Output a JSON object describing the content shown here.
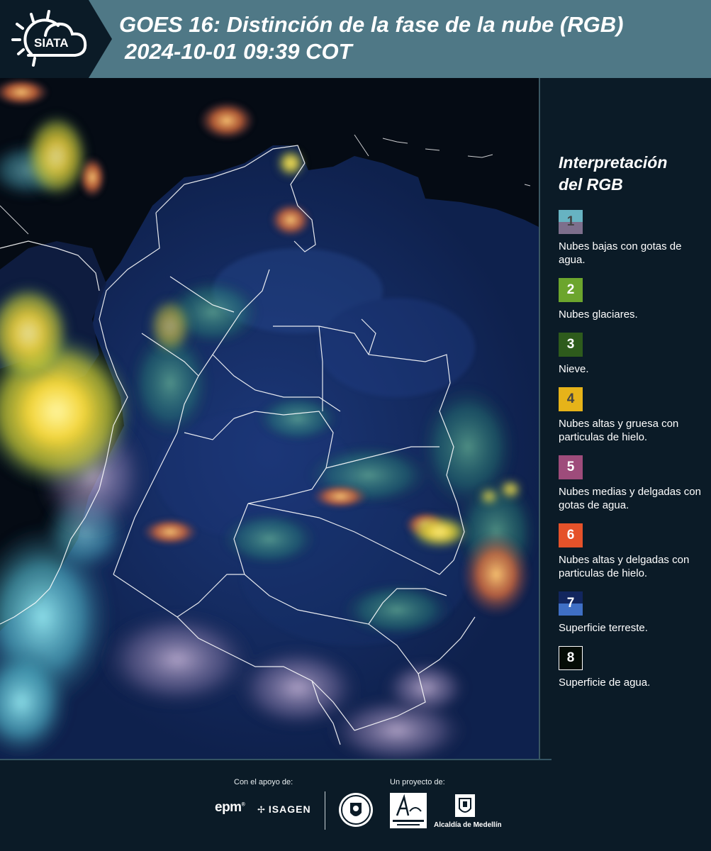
{
  "header": {
    "logo_text": "SIATA",
    "title_line1": "GOES 16: Distinción de la fase de la nube (RGB)",
    "title_line2": "2024-10-01 09:39 COT"
  },
  "legend": {
    "title_line1": "Interpretación",
    "title_line2": "del RGB",
    "items": [
      {
        "number": "1",
        "label": "Nubes bajas con gotas de agua.",
        "color_top": "#67b3c2",
        "color_bottom": "#7d6f8c",
        "number_color": "#444444"
      },
      {
        "number": "2",
        "label": "Nubes glaciares.",
        "color_top": "#6ca52d",
        "color_bottom": "#6ca52d",
        "number_color": "#ffffff"
      },
      {
        "number": "3",
        "label": "Nieve.",
        "color_top": "#2e5b1c",
        "color_bottom": "#2e5b1c",
        "number_color": "#ffffff"
      },
      {
        "number": "4",
        "label": "Nubes altas y gruesa con particulas de hielo.",
        "color_top": "#e6b319",
        "color_bottom": "#e6b319",
        "number_color": "#444444"
      },
      {
        "number": "5",
        "label": "Nubes medias y delgadas con gotas de agua.",
        "color_top": "#9e4c7b",
        "color_bottom": "#9e4c7b",
        "number_color": "#ffffff"
      },
      {
        "number": "6",
        "label": "Nubes altas y delgadas con particulas de hielo.",
        "color_top": "#e5522a",
        "color_bottom": "#e5522a",
        "number_color": "#ffffff"
      },
      {
        "number": "7",
        "label": "Superficie terreste.",
        "color_top": "#12265e",
        "color_bottom": "#3f6fc4",
        "number_color": "#ffffff"
      },
      {
        "number": "8",
        "label": "Superficie de agua.",
        "color_top": "#050c06",
        "color_bottom": "#050c06",
        "number_color": "#ffffff"
      }
    ]
  },
  "footer": {
    "support_label": "Con el apoyo de:",
    "project_label": "Un proyecto de:",
    "sponsor_epm": "epm",
    "sponsor_isagen": "ISAGEN",
    "partner_alcaldia": "Alcaldía de Medellín"
  },
  "colors": {
    "header_bg": "#4f7886",
    "page_bg": "#0b1b27",
    "boundary_line": "#ffffff"
  }
}
